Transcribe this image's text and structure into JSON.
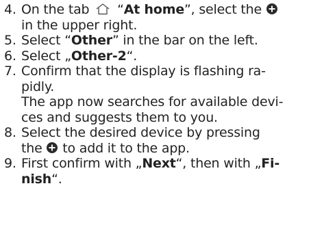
{
  "cut_line": "4. ... 1 . ... . ... ... ...",
  "steps": [
    {
      "number": "4.",
      "line1_a": "On the tab ",
      "line1_b": " “",
      "line1_bold": "At home",
      "line1_c": "”, select the ",
      "line2": "in the upper right."
    },
    {
      "number": "5.",
      "a": "Select “",
      "bold": "Other",
      "b": "” in the bar on the left."
    },
    {
      "number": "6.",
      "a": "Select „",
      "bold": "Other-2",
      "b": "“."
    },
    {
      "number": "7.",
      "line1": "Confirm that the display is flashing ra-",
      "line2": "pidly.",
      "note1": "The app now searches for available devi-",
      "note2": "ces and suggests them to you."
    },
    {
      "number": "8.",
      "line1": "Select the desired device by pressing",
      "line2_a": "the ",
      "line2_b": " to add it to the app."
    },
    {
      "number": "9.",
      "line1_a": "First confirm with „",
      "line1_bold1": "Next",
      "line1_b": "“, then with „",
      "line1_bold2": "Fi-",
      "line2_bold": "nish",
      "line2_b": "“."
    }
  ],
  "icons": {
    "home": "home-icon",
    "add": "plus-circle-icon"
  },
  "colors": {
    "text": "#222222",
    "icon": "#2a2a2a",
    "background": "#ffffff"
  }
}
